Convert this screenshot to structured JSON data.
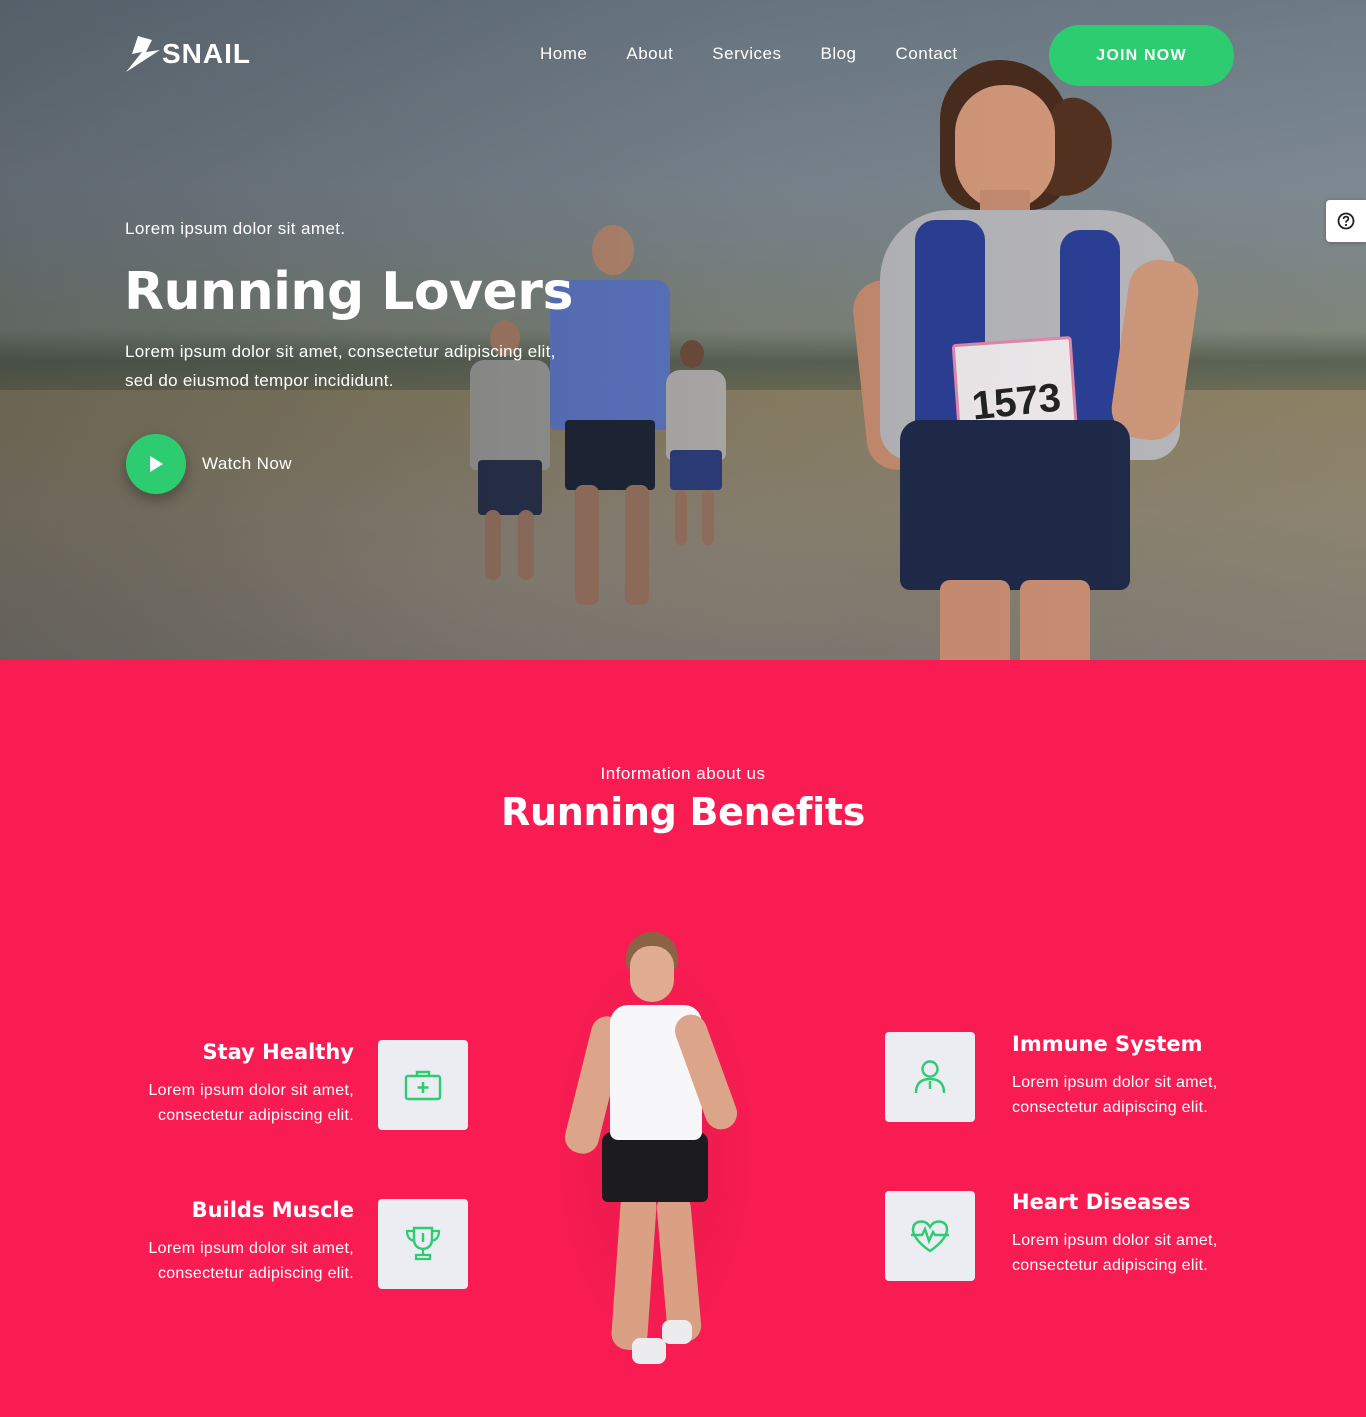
{
  "brand": {
    "name": "SNAIL"
  },
  "nav": {
    "items": [
      "Home",
      "About",
      "Services",
      "Blog",
      "Contact"
    ],
    "cta": "JOIN NOW"
  },
  "hero": {
    "subtitle": "Lorem ipsum dolor sit amet.",
    "title": "Running Lovers",
    "text": "Lorem ipsum dolor sit amet, consectetur adipiscing elit, sed do eiusmod tempor incididunt.",
    "watch_label": "Watch Now",
    "bib_number": "1573"
  },
  "help": {
    "icon": "question-circle-icon"
  },
  "benefits": {
    "subtitle": "Information about us",
    "title": "Running Benefits",
    "items": [
      {
        "title": "Stay Healthy",
        "text": "Lorem ipsum dolor sit amet, consectetur adipiscing elit.",
        "icon": "medical-kit-icon"
      },
      {
        "title": "Builds Muscle",
        "text": "Lorem ipsum dolor sit amet, consectetur adipiscing elit.",
        "icon": "trophy-icon"
      },
      {
        "title": "Immune System",
        "text": "Lorem ipsum dolor sit amet, consectetur adipiscing elit.",
        "icon": "user-icon"
      },
      {
        "title": "Heart Diseases",
        "text": "Lorem ipsum dolor sit amet, consectetur adipiscing elit.",
        "icon": "heart-pulse-icon"
      }
    ]
  },
  "colors": {
    "accent": "#2ecc71",
    "section_bg": "#f81c52",
    "icon_box": "#ebedf3"
  }
}
